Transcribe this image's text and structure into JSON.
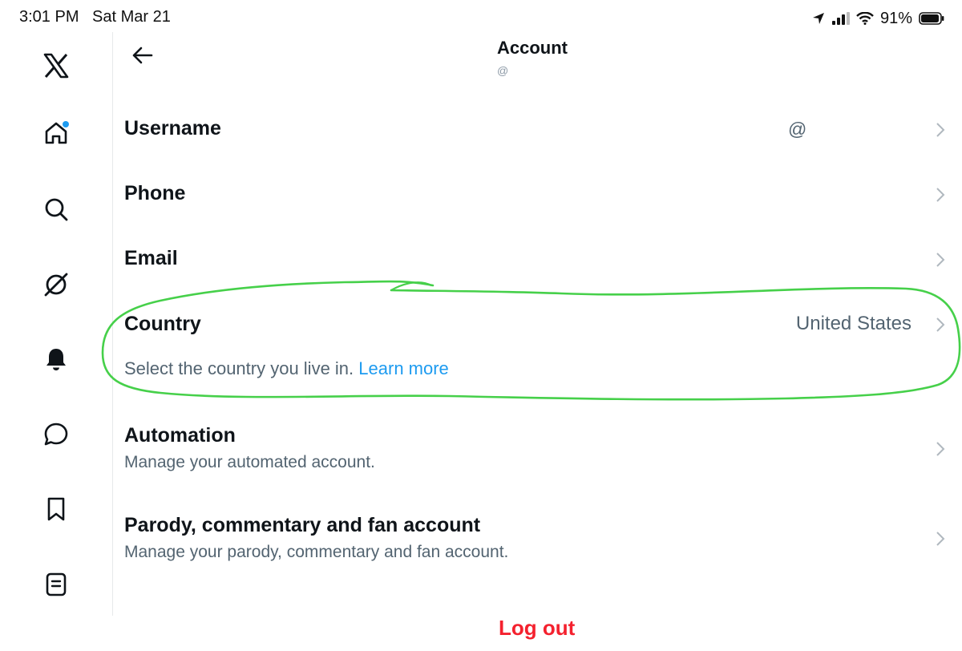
{
  "status_bar": {
    "time": "3:01 PM",
    "date": "Sat Mar 21",
    "battery": "91%",
    "icons": [
      "location-arrow-icon",
      "cellular-signal-icon",
      "wifi-icon",
      "battery-icon"
    ]
  },
  "sidebar": {
    "items": [
      {
        "icon": "x-logo-icon"
      },
      {
        "icon": "home-icon",
        "has_notification_dot": true
      },
      {
        "icon": "search-icon"
      },
      {
        "icon": "grok-icon"
      },
      {
        "icon": "notifications-bell-icon"
      },
      {
        "icon": "messages-icon"
      },
      {
        "icon": "bookmarks-icon"
      },
      {
        "icon": "lists-icon"
      }
    ]
  },
  "header": {
    "back_icon": "back-arrow-icon",
    "title": "Account",
    "handle": "@"
  },
  "rows": {
    "username": {
      "label": "Username",
      "value": "@"
    },
    "phone": {
      "label": "Phone"
    },
    "email": {
      "label": "Email"
    },
    "country": {
      "label": "Country",
      "value": "United States",
      "description": "Select the country you live in.",
      "link": "Learn more"
    },
    "automation": {
      "label": "Automation",
      "description": "Manage your automated account."
    },
    "parody": {
      "label": "Parody, commentary and fan account",
      "description": "Manage your parody, commentary and fan account."
    }
  },
  "footer": {
    "logout": "Log out"
  },
  "colors": {
    "text_primary": "#0f1419",
    "text_secondary": "#536471",
    "link": "#1d9bf0",
    "danger": "#f4212e",
    "annotation": "#3ecf3e"
  }
}
